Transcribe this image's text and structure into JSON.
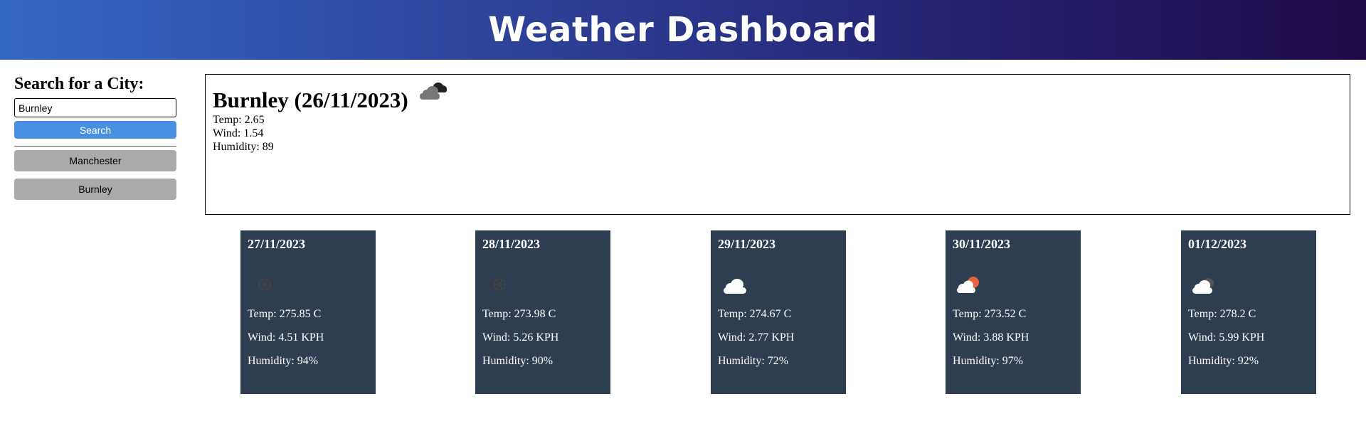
{
  "header": {
    "title": "Weather Dashboard"
  },
  "sidebar": {
    "heading": "Search for a City:",
    "search_value": "Burnley",
    "search_button": "Search",
    "history": [
      "Manchester",
      "Burnley"
    ]
  },
  "current": {
    "title": "Burnley (26/11/2023)",
    "icon": "broken-clouds-icon",
    "temp": "Temp: 2.65",
    "wind": "Wind: 1.54",
    "humidity": "Humidity: 89"
  },
  "forecast": [
    {
      "date": "27/11/2023",
      "icon": "snow-icon",
      "temp": "Temp: 275.85 C",
      "wind": "Wind: 4.51 KPH",
      "humidity": "Humidity: 94%"
    },
    {
      "date": "28/11/2023",
      "icon": "snow-icon",
      "temp": "Temp: 273.98 C",
      "wind": "Wind: 5.26 KPH",
      "humidity": "Humidity: 90%"
    },
    {
      "date": "29/11/2023",
      "icon": "cloud-icon",
      "temp": "Temp: 274.67 C",
      "wind": "Wind: 2.77 KPH",
      "humidity": "Humidity: 72%"
    },
    {
      "date": "30/11/2023",
      "icon": "sun-cloud-icon",
      "temp": "Temp: 273.52 C",
      "wind": "Wind: 3.88 KPH",
      "humidity": "Humidity: 97%"
    },
    {
      "date": "01/12/2023",
      "icon": "night-cloud-icon",
      "temp": "Temp: 278.2 C",
      "wind": "Wind: 5.99 KPH",
      "humidity": "Humidity: 92%"
    }
  ]
}
